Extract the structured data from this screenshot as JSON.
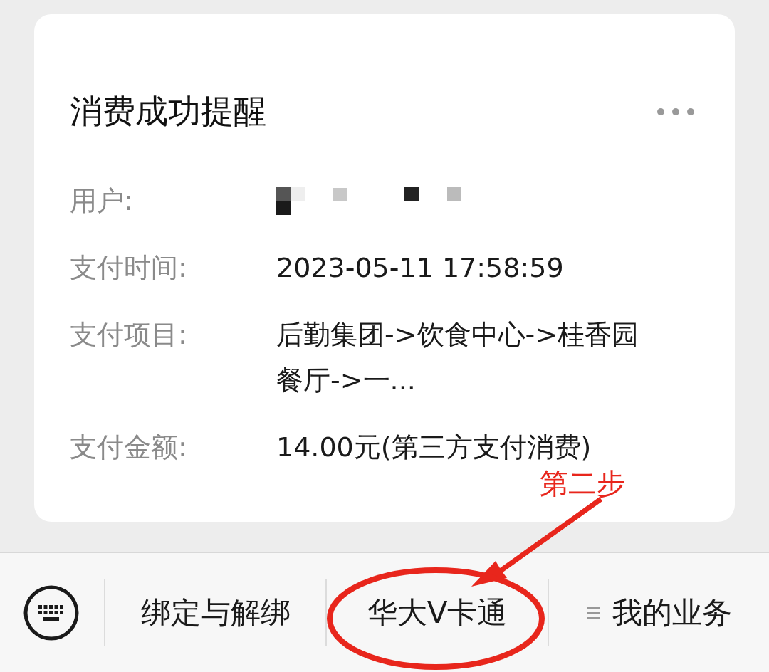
{
  "card": {
    "title": "消费成功提醒",
    "rows": [
      {
        "label": "用户:",
        "kind": "redacted"
      },
      {
        "label": "支付时间:",
        "kind": "text",
        "value": "2023-05-11 17:58:59"
      },
      {
        "label": "支付项目:",
        "kind": "text",
        "value": "后勤集团->饮食中心->桂香园餐厅->一..."
      },
      {
        "label": "支付金额:",
        "kind": "text",
        "value": "14.00元(第三方支付消费)"
      }
    ]
  },
  "menu": [
    {
      "label": "绑定与解绑",
      "has_menu_icon": false
    },
    {
      "label": "华大V卡通",
      "has_menu_icon": false
    },
    {
      "label": "我的业务",
      "has_menu_icon": true
    }
  ],
  "annotation": {
    "text": "第二步"
  }
}
